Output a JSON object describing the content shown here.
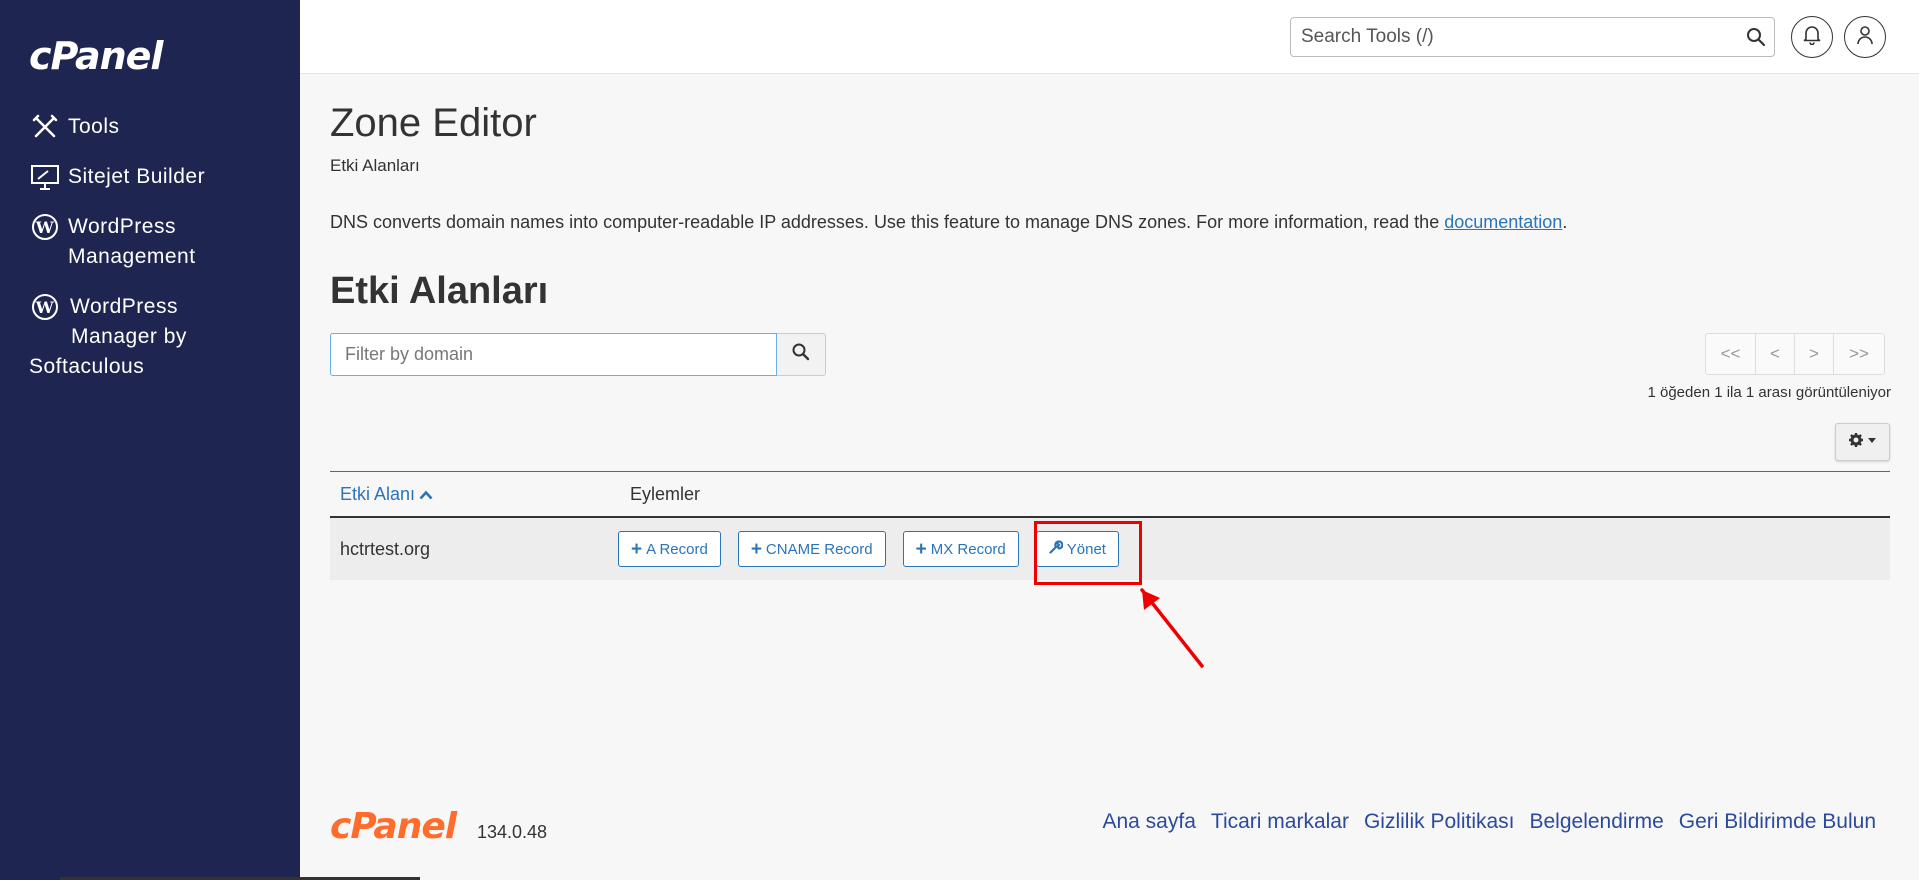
{
  "sidebar": {
    "logo": "cPanel",
    "items": [
      {
        "label": "Tools",
        "icon": "tools-icon"
      },
      {
        "label": "Sitejet Builder",
        "icon": "sitejet-icon"
      },
      {
        "label": "WordPress",
        "label2": "Management",
        "icon": "wordpress-icon"
      },
      {
        "label": "WordPress",
        "label2": "Manager by",
        "label3": "Softaculous",
        "icon": "wordpress-icon"
      }
    ]
  },
  "topbar": {
    "search_placeholder": "Search Tools (/)",
    "notification_icon": "bell-icon",
    "user_icon": "user-icon"
  },
  "page": {
    "title": "Zone Editor",
    "subtitle": "Etki Alanları",
    "description": "DNS converts domain names into computer-readable IP addresses. Use this feature to manage DNS zones. For more information, read the ",
    "doc_link": "documentation",
    "description_end": ".",
    "section_title": "Etki Alanları"
  },
  "filter": {
    "placeholder": "Filter by domain"
  },
  "pager": {
    "first": "<<",
    "prev": "<",
    "next": ">",
    "last": ">>"
  },
  "showing": "1 öğeden 1 ila 1 arası görüntüleniyor",
  "table": {
    "columns": [
      "Etki Alanı",
      "Eylemler"
    ],
    "rows": [
      {
        "domain": "hctrtest.org",
        "actions": {
          "a_record": "A Record",
          "cname_record": "CNAME Record",
          "mx_record": "MX Record",
          "manage": "Yönet"
        }
      }
    ]
  },
  "footer": {
    "logo": "cPanel",
    "version": "134.0.48",
    "links": [
      "Ana sayfa",
      "Ticari markalar",
      "Gizlilik Politikası",
      "Belgelendirme",
      "Geri Bildirimde Bulun"
    ]
  },
  "colors": {
    "sidebar_bg": "#1f2551",
    "link": "#2b74b8",
    "highlight": "#e00000",
    "brand_orange": "#ff6c2c"
  }
}
